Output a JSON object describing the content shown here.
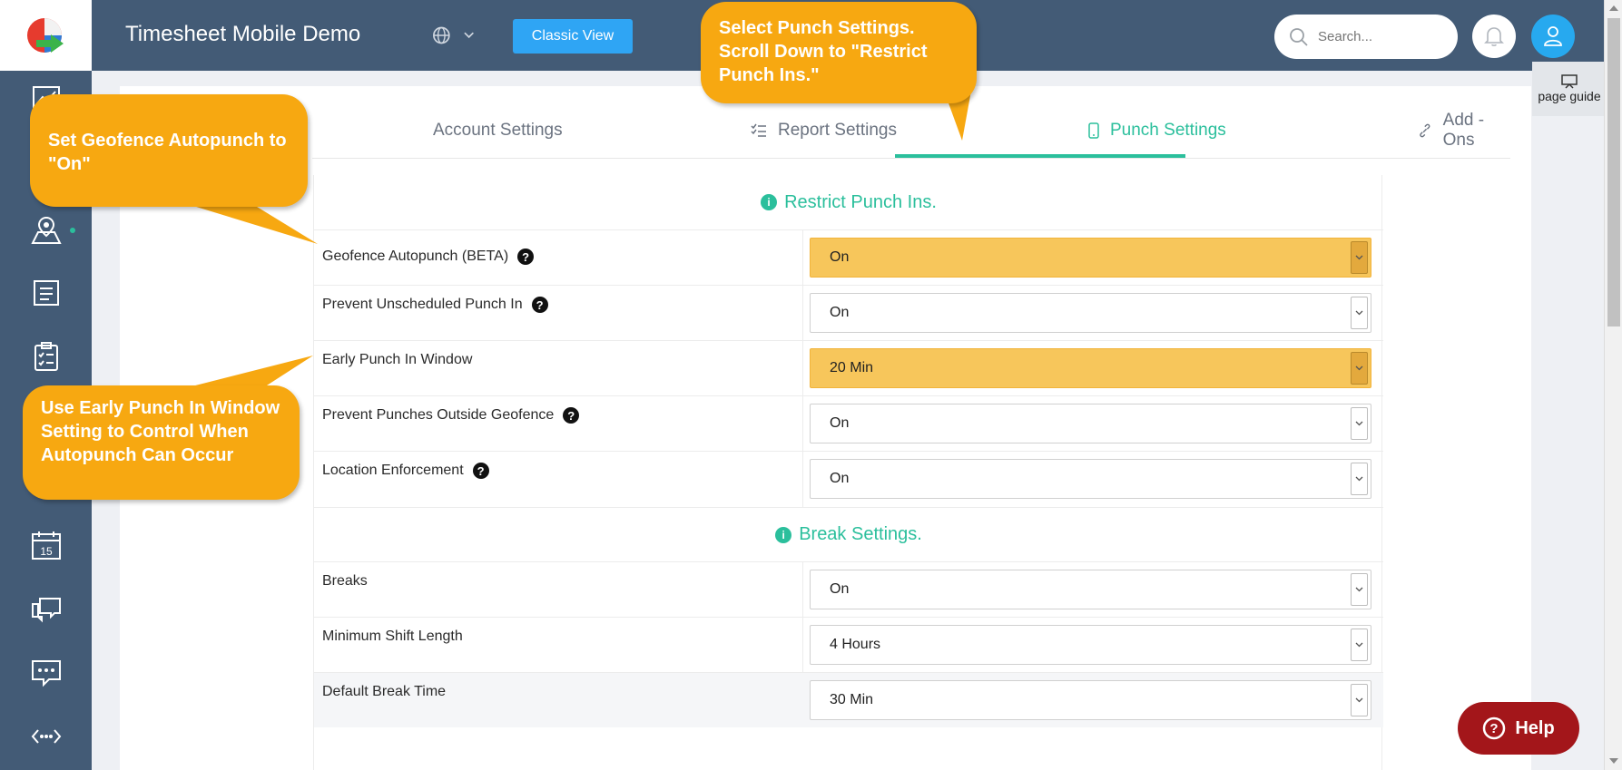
{
  "app": {
    "title": "Timesheet Mobile Demo",
    "classic_view_label": "Classic View",
    "search_placeholder": "Search...",
    "page_guide_label": "page guide",
    "help_label": "Help"
  },
  "sidebar": {
    "items": [
      {
        "icon": "chart-icon"
      },
      {
        "icon": "map-pin-icon"
      },
      {
        "icon": "notebook-icon"
      },
      {
        "icon": "clipboard-icon"
      },
      {
        "icon": "calendar-icon",
        "label": "15"
      },
      {
        "icon": "chat-icon"
      },
      {
        "icon": "message-dots-icon"
      },
      {
        "icon": "code-icon"
      }
    ]
  },
  "tabs": [
    {
      "label": "Account Settings",
      "icon": "user-icon",
      "active": false
    },
    {
      "label": "Report Settings",
      "icon": "list-check-icon",
      "active": false
    },
    {
      "label": "Punch Settings",
      "icon": "mobile-icon",
      "active": true
    },
    {
      "label": "Add - Ons",
      "icon": "link-icon",
      "active": false
    }
  ],
  "sections": {
    "restrict": {
      "title": "Restrict Punch Ins.",
      "rows": [
        {
          "label": "Geofence Autopunch (BETA)",
          "value": "On",
          "help": true,
          "highlight": true
        },
        {
          "label": "Prevent Unscheduled Punch In",
          "value": "On",
          "help": true,
          "highlight": false
        },
        {
          "label": "Early Punch In Window",
          "value": "20 Min",
          "help": false,
          "highlight": true
        },
        {
          "label": "Prevent Punches Outside Geofence",
          "value": "On",
          "help": true,
          "highlight": false
        },
        {
          "label": "Location Enforcement",
          "value": "On",
          "help": true,
          "highlight": false
        }
      ]
    },
    "breaks": {
      "title": "Break Settings.",
      "rows": [
        {
          "label": "Breaks",
          "value": "On"
        },
        {
          "label": "Minimum Shift Length",
          "value": "4 Hours"
        },
        {
          "label": "Default Break Time",
          "value": "30 Min"
        }
      ]
    }
  },
  "callouts": {
    "punch": "Select Punch Settings. Scroll Down to \"Restrict Punch Ins.\"",
    "geofence": "Set Geofence Autopunch to \"On\"",
    "early": "Use Early Punch In Window Setting to Control When Autopunch Can Occur"
  },
  "colors": {
    "accent": "#2bbf9c",
    "topbar": "#435b76",
    "callout": "#f7a811",
    "highlight": "#f7c65b",
    "help": "#a3161a"
  }
}
